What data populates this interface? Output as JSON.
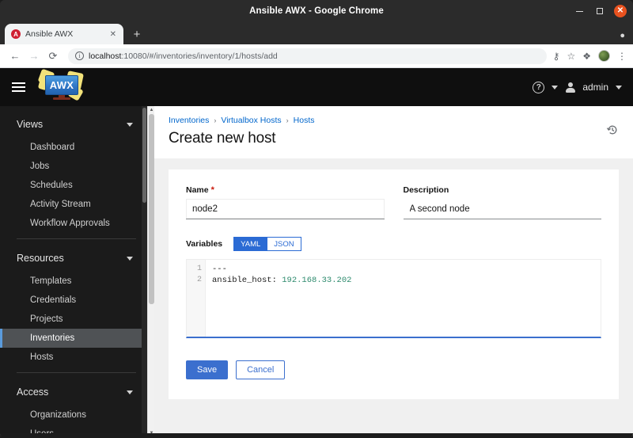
{
  "window": {
    "title": "Ansible AWX - Google Chrome",
    "minimize_label": "–",
    "maximize_label": "",
    "close_label": "✕"
  },
  "browser": {
    "tab": {
      "favicon_letter": "A",
      "title": "Ansible AWX",
      "close_label": "✕"
    },
    "new_tab_label": "+",
    "tabstrip_right_icon": "download-icon",
    "toolbar": {
      "back_label": "←",
      "forward_label": "→",
      "reload_label": "⟳",
      "site_info_label": "i",
      "url_host": "localhost",
      "url_rest": ":10080/#/inventories/inventory/1/hosts/add",
      "icons": [
        "key-icon",
        "bookmark-star-icon",
        "extensions-puzzle-icon",
        "profile-avatar",
        "chrome-menu-icon"
      ],
      "key_label": "⚷",
      "star_label": "☆",
      "puzzle_label": "❖",
      "menu_label": "⋮"
    }
  },
  "app": {
    "logo_text": "AWX",
    "header": {
      "help_label": "?",
      "user_name": "admin"
    },
    "sidebar": {
      "groups": [
        {
          "title": "Views",
          "items": [
            {
              "label": "Dashboard",
              "active": false
            },
            {
              "label": "Jobs",
              "active": false
            },
            {
              "label": "Schedules",
              "active": false
            },
            {
              "label": "Activity Stream",
              "active": false
            },
            {
              "label": "Workflow Approvals",
              "active": false
            }
          ]
        },
        {
          "title": "Resources",
          "items": [
            {
              "label": "Templates",
              "active": false
            },
            {
              "label": "Credentials",
              "active": false
            },
            {
              "label": "Projects",
              "active": false
            },
            {
              "label": "Inventories",
              "active": true
            },
            {
              "label": "Hosts",
              "active": false
            }
          ]
        },
        {
          "title": "Access",
          "items": [
            {
              "label": "Organizations",
              "active": false
            },
            {
              "label": "Users",
              "active": false
            }
          ]
        }
      ]
    },
    "page": {
      "breadcrumb": [
        {
          "label": "Inventories"
        },
        {
          "label": "Virtualbox Hosts"
        },
        {
          "label": "Hosts"
        }
      ],
      "breadcrumb_separator": "›",
      "title": "Create new host",
      "history_icon": "history-rewind-icon"
    },
    "form": {
      "name_label": "Name",
      "name_required": "*",
      "name_value": "node2",
      "description_label": "Description",
      "description_value": "A second node",
      "variables_label": "Variables",
      "toggle": {
        "yaml_label": "YAML",
        "json_label": "JSON",
        "selected": "YAML"
      },
      "editor": {
        "line_numbers": [
          "1",
          "2"
        ],
        "line1": "---",
        "line2_key": "ansible_host: ",
        "line2_value": "192.168.33.202"
      },
      "save_label": "Save",
      "cancel_label": "Cancel"
    }
  },
  "colors": {
    "accent_blue": "#3b6fce",
    "link_blue": "#0066cc",
    "sidebar_bg": "#1b1b1b",
    "header_bg": "#0f0f0f",
    "required_red": "#c9190b",
    "close_orange": "#e8521f"
  }
}
